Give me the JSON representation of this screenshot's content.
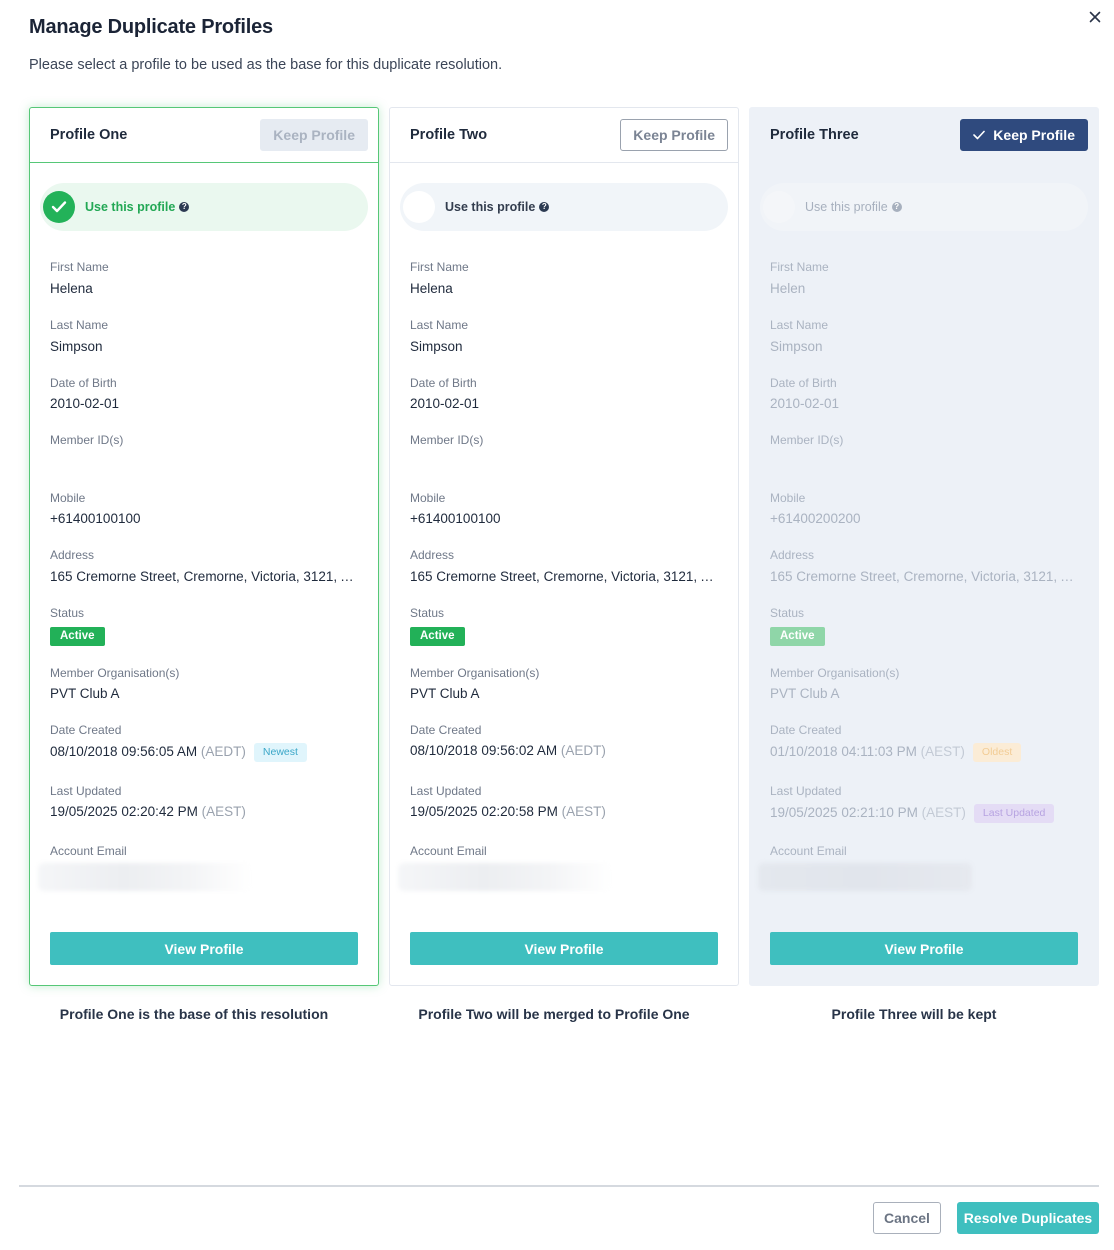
{
  "modal": {
    "title": "Manage Duplicate Profiles",
    "subtitle": "Please select a profile to be used as the base for this duplicate resolution."
  },
  "labels": {
    "keep_profile": "Keep Profile",
    "use_this_profile": "Use this profile",
    "first_name": "First Name",
    "last_name": "Last Name",
    "date_of_birth": "Date of Birth",
    "member_ids": "Member ID(s)",
    "mobile": "Mobile",
    "address": "Address",
    "status": "Status",
    "member_orgs": "Member Organisation(s)",
    "date_created": "Date Created",
    "last_updated": "Last Updated",
    "account_email": "Account Email",
    "view_profile": "View Profile"
  },
  "profiles": [
    {
      "name": "Profile One",
      "selected": true,
      "first_name": "Helena",
      "last_name": "Simpson",
      "dob": "2010-02-01",
      "member_ids": "",
      "mobile": "+61400100100",
      "address": "165 Cremorne Street, Cremorne, Victoria, 3121, Au...",
      "status": "Active",
      "member_org": "PVT Club A",
      "date_created": "08/10/2018 09:56:05 AM",
      "date_created_tz": "(AEDT)",
      "date_created_tag": "Newest",
      "last_updated": "19/05/2025 02:20:42 PM",
      "last_updated_tz": "(AEST)",
      "last_updated_tag": "",
      "caption": "Profile One is the base of this resolution"
    },
    {
      "name": "Profile Two",
      "selected": false,
      "first_name": "Helena",
      "last_name": "Simpson",
      "dob": "2010-02-01",
      "member_ids": "",
      "mobile": "+61400100100",
      "address": "165 Cremorne Street, Cremorne, Victoria, 3121, Au...",
      "status": "Active",
      "member_org": "PVT Club A",
      "date_created": "08/10/2018 09:56:02 AM",
      "date_created_tz": "(AEDT)",
      "date_created_tag": "",
      "last_updated": "19/05/2025 02:20:58 PM",
      "last_updated_tz": "(AEST)",
      "last_updated_tag": "",
      "caption": "Profile Two will be merged to Profile One"
    },
    {
      "name": "Profile Three",
      "selected": false,
      "keep": true,
      "first_name": "Helen",
      "last_name": "Simpson",
      "dob": "2010-02-01",
      "member_ids": "",
      "mobile": "+61400200200",
      "address": "165 Cremorne Street, Cremorne, Victoria, 3121, Au...",
      "status": "Active",
      "member_org": "PVT Club A",
      "date_created": "01/10/2018 04:11:03 PM",
      "date_created_tz": "(AEST)",
      "date_created_tag": "Oldest",
      "last_updated": "19/05/2025 02:21:10 PM",
      "last_updated_tz": "(AEST)",
      "last_updated_tag": "Last Updated",
      "caption": "Profile Three will be kept"
    }
  ],
  "footer": {
    "cancel": "Cancel",
    "resolve": "Resolve Duplicates"
  },
  "colors": {
    "accent_teal": "#3fbfbf",
    "selected_green": "#23b259",
    "keep_navy": "#2f4a7e",
    "status_green": "#22b158"
  },
  "icons": {
    "close": "close-icon",
    "check": "check-icon",
    "info": "info-icon"
  }
}
